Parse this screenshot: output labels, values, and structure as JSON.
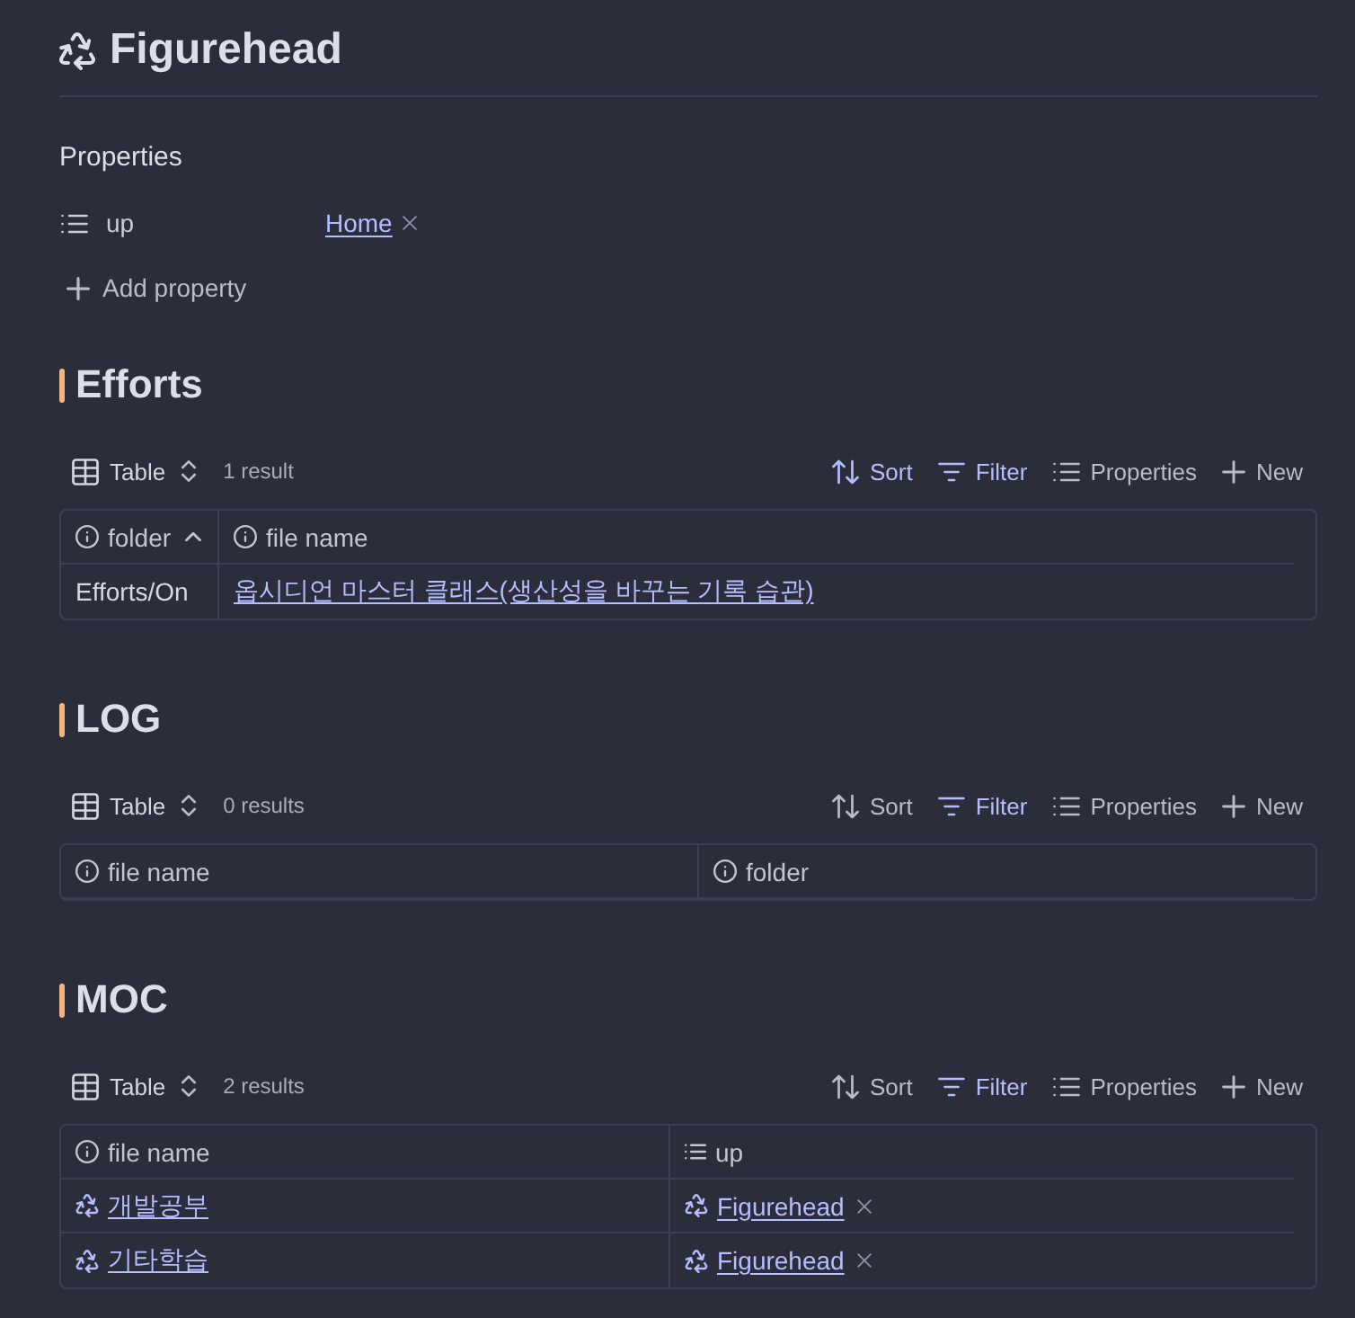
{
  "page": {
    "title": "Figurehead"
  },
  "properties": {
    "heading": "Properties",
    "items": [
      {
        "name": "up",
        "kind": "list",
        "values": [
          {
            "kind": "link",
            "text": "Home"
          }
        ]
      }
    ],
    "add_label": "Add property"
  },
  "sections": [
    {
      "heading": "Efforts",
      "toolbar": {
        "view": "Table",
        "count": "1 result",
        "actions": [
          {
            "kind": "sort",
            "label": "Sort",
            "active": true
          },
          {
            "kind": "filter",
            "label": "Filter",
            "active": true
          },
          {
            "kind": "properties",
            "label": "Properties",
            "active": false
          },
          {
            "kind": "new",
            "label": "New",
            "active": false
          }
        ]
      },
      "table": {
        "columns": [
          {
            "kind": "file",
            "label": "folder",
            "sorted": true
          },
          {
            "kind": "file",
            "label": "file name",
            "sorted": false
          }
        ],
        "rows": [
          [
            {
              "kind": "text",
              "text": "Efforts/On"
            },
            {
              "kind": "link",
              "text": "옵시디언 마스터 클래스(생산성을 바꾸는 기록 습관)"
            }
          ]
        ]
      }
    },
    {
      "heading": "LOG",
      "toolbar": {
        "view": "Table",
        "count": "0 results",
        "actions": [
          {
            "kind": "sort",
            "label": "Sort",
            "active": false
          },
          {
            "kind": "filter",
            "label": "Filter",
            "active": true
          },
          {
            "kind": "properties",
            "label": "Properties",
            "active": false
          },
          {
            "kind": "new",
            "label": "New",
            "active": false
          }
        ]
      },
      "table": {
        "columns": [
          {
            "kind": "file",
            "label": "file name",
            "sorted": false
          },
          {
            "kind": "file",
            "label": "folder",
            "sorted": false
          }
        ]
      }
    },
    {
      "heading": "MOC",
      "toolbar": {
        "view": "Table",
        "count": "2 results",
        "actions": [
          {
            "kind": "sort",
            "label": "Sort",
            "active": false
          },
          {
            "kind": "filter",
            "label": "Filter",
            "active": true
          },
          {
            "kind": "properties",
            "label": "Properties",
            "active": false
          },
          {
            "kind": "new",
            "label": "New",
            "active": false
          }
        ]
      },
      "table": {
        "columns": [
          {
            "kind": "file",
            "label": "file name",
            "sorted": false
          },
          {
            "kind": "list",
            "label": "up",
            "sorted": false
          }
        ],
        "rows": [
          [
            {
              "kind": "icon-link",
              "text": "개발공부"
            },
            {
              "kind": "list",
              "items": [
                {
                  "kind": "icon-link",
                  "text": "Figurehead"
                }
              ]
            }
          ],
          [
            {
              "kind": "icon-link",
              "text": "기타학습"
            },
            {
              "kind": "list",
              "items": [
                {
                  "kind": "icon-link",
                  "text": "Figurehead"
                }
              ]
            }
          ]
        ]
      }
    }
  ]
}
